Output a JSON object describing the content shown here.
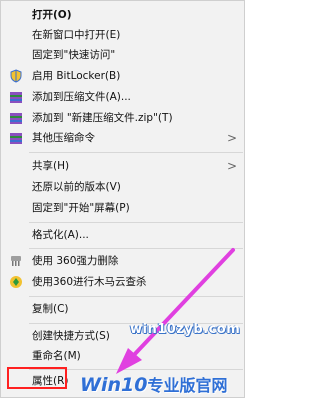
{
  "menu": {
    "items": [
      {
        "label": "打开(O)"
      },
      {
        "label": "在新窗口中打开(E)"
      },
      {
        "label": "固定到\"快速访问\""
      },
      {
        "label": "启用 BitLocker(B)"
      },
      {
        "label": "添加到压缩文件(A)..."
      },
      {
        "label": "添加到 \"新建压缩文件.zip\"(T)"
      },
      {
        "label": "其他压缩命令"
      },
      {
        "label": "共享(H)"
      },
      {
        "label": "还原以前的版本(V)"
      },
      {
        "label": "固定到\"开始\"屏幕(P)"
      },
      {
        "label": "格式化(A)..."
      },
      {
        "label": "使用 360强力删除"
      },
      {
        "label": "使用360进行木马云查杀"
      },
      {
        "label": "复制(C)"
      },
      {
        "label": "创建快捷方式(S)"
      },
      {
        "label": "重命名(M)"
      },
      {
        "label": "属性(R)"
      }
    ],
    "submenu_arrow": ">"
  },
  "watermark": {
    "url": "win10zyb.com",
    "logo_latin": "Win10",
    "logo_cn": "专业版官网"
  },
  "colors": {
    "menu_bg": "#f2f2f2",
    "highlight": "#ff2020",
    "arrow": "#e040e0",
    "watermark_blue": "#2f6fd6"
  }
}
